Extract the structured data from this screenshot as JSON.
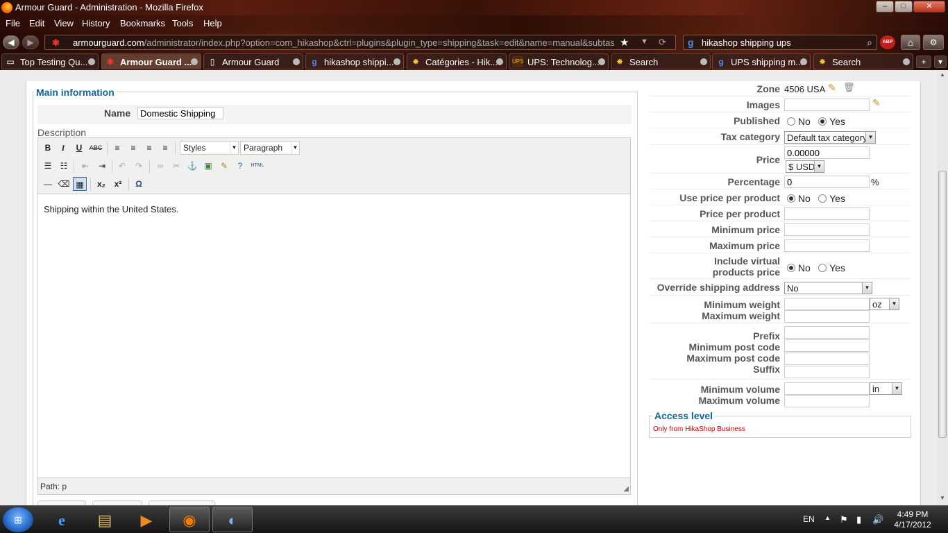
{
  "window": {
    "title": "Armour Guard - Administration - Mozilla Firefox",
    "minimize": "–",
    "maximize": "□",
    "close": "✕"
  },
  "menu": [
    "File",
    "Edit",
    "View",
    "History",
    "Bookmarks",
    "Tools",
    "Help"
  ],
  "nav": {
    "url_host": "armourguard.com",
    "url_path": "/administrator/index.php?option=com_hikashop&ctrl=plugins&plugin_type=shipping&task=edit&name=manual&subtask=shi",
    "search_query": "hikashop shipping ups",
    "abp_label": "ABP"
  },
  "tabs": [
    {
      "label": "Top Testing Qu...",
      "icon": "bookmark-icon"
    },
    {
      "label": "Armour Guard ...",
      "icon": "joomla-icon",
      "active": true
    },
    {
      "label": "Armour Guard",
      "icon": "page-icon"
    },
    {
      "label": "hikashop shippi...",
      "icon": "google-icon"
    },
    {
      "label": "Catégories - Hik...",
      "icon": "star-icon"
    },
    {
      "label": "UPS: Technolog...",
      "icon": "ups-icon"
    },
    {
      "label": "Search",
      "icon": "star-icon"
    },
    {
      "label": "UPS shipping m...",
      "icon": "google-icon"
    },
    {
      "label": "Search",
      "icon": "star-icon"
    }
  ],
  "main_info": {
    "legend": "Main information",
    "name_label": "Name",
    "name_value": "Domestic Shipping",
    "description_label": "Description",
    "styles_select": "Styles",
    "paragraph_select": "Paragraph",
    "editor_text": "Shipping within the United States.",
    "path_text": "Path: p"
  },
  "right_panel": {
    "zone_label": "Zone",
    "zone_value": "4506 USA",
    "images_label": "Images",
    "published_label": "Published",
    "published": {
      "no": "No",
      "yes": "Yes",
      "selected": "Yes"
    },
    "tax_label": "Tax category",
    "tax_value": "Default tax category",
    "price_label": "Price",
    "price_value": "0.00000",
    "currency_value": "$ USD",
    "percentage_label": "Percentage",
    "percentage_value": "0",
    "percentage_unit": "%",
    "use_price_per_product_label": "Use price per product",
    "use_price_per_product": {
      "no": "No",
      "yes": "Yes",
      "selected": "No"
    },
    "price_per_product_label": "Price per product",
    "minimum_price_label": "Minimum price",
    "maximum_price_label": "Maximum price",
    "include_virtual_label_1": "Include virtual",
    "include_virtual_label_2": "products price",
    "include_virtual": {
      "no": "No",
      "yes": "Yes",
      "selected": "No"
    },
    "override_label": "Override shipping address",
    "override_value": "No",
    "min_weight_label": "Minimum weight",
    "weight_unit": "oz",
    "max_weight_label": "Maximum weight",
    "prefix_label": "Prefix",
    "min_post_label": "Minimum post code",
    "max_post_label": "Maximum post code",
    "suffix_label": "Suffix",
    "min_volume_label": "Minimum volume",
    "volume_unit": "in",
    "max_volume_label": "Maximum volume",
    "access_legend": "Access level",
    "access_note": "Only from HikaShop Business"
  },
  "taskbar": {
    "language": "EN",
    "time": "4:49 PM",
    "date": "4/17/2012"
  },
  "colors": {
    "legend_blue": "#146295",
    "access_note_red": "#cc0000"
  }
}
